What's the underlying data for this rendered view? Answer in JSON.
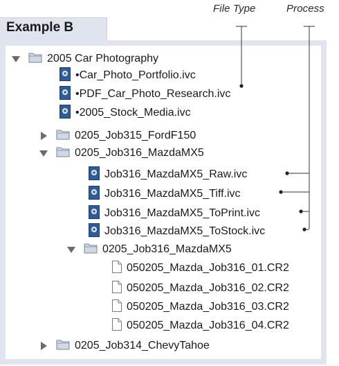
{
  "annotations": {
    "file_type": "File Type",
    "process": "Process"
  },
  "header": {
    "title": "Example B"
  },
  "tree": {
    "root": {
      "label": "2005 Car Photography",
      "icon": "folder-icon",
      "expanded": true
    },
    "root_files": [
      {
        "label": "•Car_Photo_Portfolio.ivc",
        "icon": "ivc-catalog-icon"
      },
      {
        "label": "•PDF_Car_Photo_Research.ivc",
        "icon": "ivc-catalog-icon"
      },
      {
        "label": "•2005_Stock_Media.ivc",
        "icon": "ivc-catalog-icon"
      }
    ],
    "job315": {
      "label": "0205_Job315_FordF150",
      "icon": "folder-icon",
      "expanded": false
    },
    "job316": {
      "label": "0205_Job316_MazdaMX5",
      "icon": "folder-icon",
      "expanded": true
    },
    "job316_files": [
      {
        "label": "Job316_MazdaMX5_Raw.ivc",
        "icon": "ivc-catalog-icon"
      },
      {
        "label": "Job316_MazdaMX5_Tiff.ivc",
        "icon": "ivc-catalog-icon"
      },
      {
        "label": "Job316_MazdaMX5_ToPrint.ivc",
        "icon": "ivc-catalog-icon"
      },
      {
        "label": "Job316_MazdaMX5_ToStock.ivc",
        "icon": "ivc-catalog-icon"
      }
    ],
    "job316_sub": {
      "label": "0205_Job316_MazdaMX5",
      "icon": "folder-icon",
      "expanded": true
    },
    "raw_files": [
      {
        "label": "050205_Mazda_Job316_01.CR2",
        "icon": "document-icon"
      },
      {
        "label": "050205_Mazda_Job316_02.CR2",
        "icon": "document-icon"
      },
      {
        "label": "050205_Mazda_Job316_03.CR2",
        "icon": "document-icon"
      },
      {
        "label": "050205_Mazda_Job316_04.CR2",
        "icon": "document-icon"
      }
    ],
    "job314": {
      "label": "0205_Job314_ChevyTahoe",
      "icon": "folder-icon",
      "expanded": false
    }
  },
  "colors": {
    "frame": "#dfe4ef",
    "folder": "#cfd8e6",
    "catalog_icon": "#2f5b96",
    "triangle": "#6b6b6b"
  }
}
